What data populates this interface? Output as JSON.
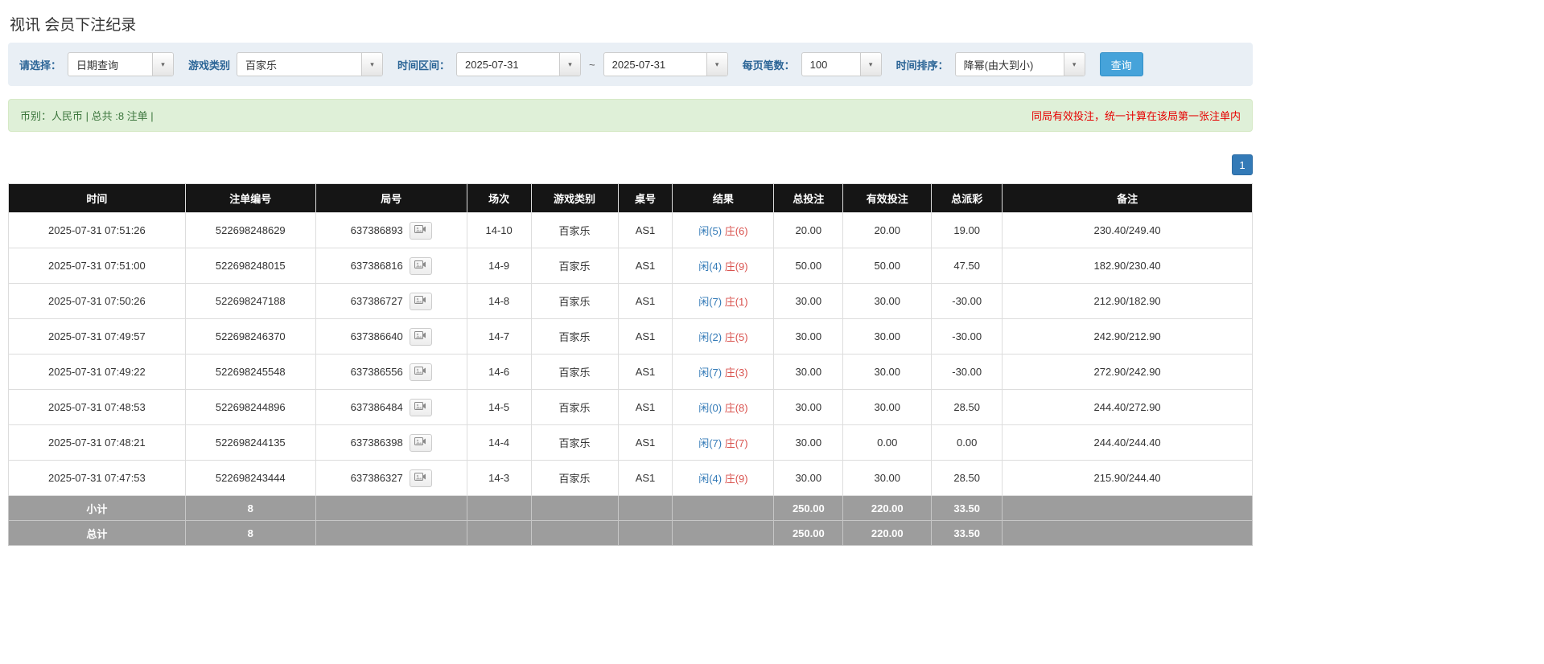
{
  "page": {
    "title": "视讯 会员下注纪录"
  },
  "colors": {
    "accent_blue": "#337ab7",
    "label_blue": "#2a6496",
    "negative_red": "#e53935",
    "banker_red": "#d9534f",
    "notice_red": "#e60000",
    "success_green_bg": "#dff0d8",
    "header_black": "#151515",
    "footer_gray": "#9d9d9d"
  },
  "icons": {
    "caret_down": "▾",
    "round_detail": "video-record-icon"
  },
  "filters": {
    "select_label": "请选择：",
    "select_value": "日期查询",
    "game_type_label": "游戏类别",
    "game_type_value": "百家乐",
    "date_range_label": "时间区间：",
    "date_from": "2025-07-31",
    "tilde": "~",
    "date_to": "2025-07-31",
    "page_size_label": "每页笔数：",
    "page_size_value": "100",
    "sort_label": "时间排序：",
    "sort_value": "降幂(由大到小)",
    "search_button": "查询"
  },
  "summary": {
    "left_text": "币别：人民币 | 总共 :8 注单 |",
    "right_notice": "同局有效投注，统一计算在该局第一张注单内"
  },
  "pagination": {
    "current_page": "1"
  },
  "table": {
    "headers": [
      "时间",
      "注单编号",
      "局号",
      "场次",
      "游戏类别",
      "桌号",
      "结果",
      "总投注",
      "有效投注",
      "总派彩",
      "备注"
    ],
    "rows": [
      {
        "time": "2025-07-31 07:51:26",
        "bet_id": "522698248629",
        "round_id": "637386893",
        "session": "14-10",
        "game": "百家乐",
        "table_no": "AS1",
        "result_player": "闲(5)",
        "result_banker": "庄(6)",
        "total_bet": "20.00",
        "valid_bet": "20.00",
        "payout": "19.00",
        "remark": "230.40/249.40"
      },
      {
        "time": "2025-07-31 07:51:00",
        "bet_id": "522698248015",
        "round_id": "637386816",
        "session": "14-9",
        "game": "百家乐",
        "table_no": "AS1",
        "result_player": "闲(4)",
        "result_banker": "庄(9)",
        "total_bet": "50.00",
        "valid_bet": "50.00",
        "payout": "47.50",
        "remark": "182.90/230.40"
      },
      {
        "time": "2025-07-31 07:50:26",
        "bet_id": "522698247188",
        "round_id": "637386727",
        "session": "14-8",
        "game": "百家乐",
        "table_no": "AS1",
        "result_player": "闲(7)",
        "result_banker": "庄(1)",
        "total_bet": "30.00",
        "valid_bet": "30.00",
        "payout": "-30.00",
        "remark": "212.90/182.90"
      },
      {
        "time": "2025-07-31 07:49:57",
        "bet_id": "522698246370",
        "round_id": "637386640",
        "session": "14-7",
        "game": "百家乐",
        "table_no": "AS1",
        "result_player": "闲(2)",
        "result_banker": "庄(5)",
        "total_bet": "30.00",
        "valid_bet": "30.00",
        "payout": "-30.00",
        "remark": "242.90/212.90"
      },
      {
        "time": "2025-07-31 07:49:22",
        "bet_id": "522698245548",
        "round_id": "637386556",
        "session": "14-6",
        "game": "百家乐",
        "table_no": "AS1",
        "result_player": "闲(7)",
        "result_banker": "庄(3)",
        "total_bet": "30.00",
        "valid_bet": "30.00",
        "payout": "-30.00",
        "remark": "272.90/242.90"
      },
      {
        "time": "2025-07-31 07:48:53",
        "bet_id": "522698244896",
        "round_id": "637386484",
        "session": "14-5",
        "game": "百家乐",
        "table_no": "AS1",
        "result_player": "闲(0)",
        "result_banker": "庄(8)",
        "total_bet": "30.00",
        "valid_bet": "30.00",
        "payout": "28.50",
        "remark": "244.40/272.90"
      },
      {
        "time": "2025-07-31 07:48:21",
        "bet_id": "522698244135",
        "round_id": "637386398",
        "session": "14-4",
        "game": "百家乐",
        "table_no": "AS1",
        "result_player": "闲(7)",
        "result_banker": "庄(7)",
        "total_bet": "30.00",
        "valid_bet": "0.00",
        "payout": "0.00",
        "remark": "244.40/244.40"
      },
      {
        "time": "2025-07-31 07:47:53",
        "bet_id": "522698243444",
        "round_id": "637386327",
        "session": "14-3",
        "game": "百家乐",
        "table_no": "AS1",
        "result_player": "闲(4)",
        "result_banker": "庄(9)",
        "total_bet": "30.00",
        "valid_bet": "30.00",
        "payout": "28.50",
        "remark": "215.90/244.40"
      }
    ],
    "subtotal": {
      "label": "小计",
      "count": "8",
      "total_bet": "250.00",
      "valid_bet": "220.00",
      "payout": "33.50"
    },
    "total": {
      "label": "总计",
      "count": "8",
      "total_bet": "250.00",
      "valid_bet": "220.00",
      "payout": "33.50"
    }
  }
}
